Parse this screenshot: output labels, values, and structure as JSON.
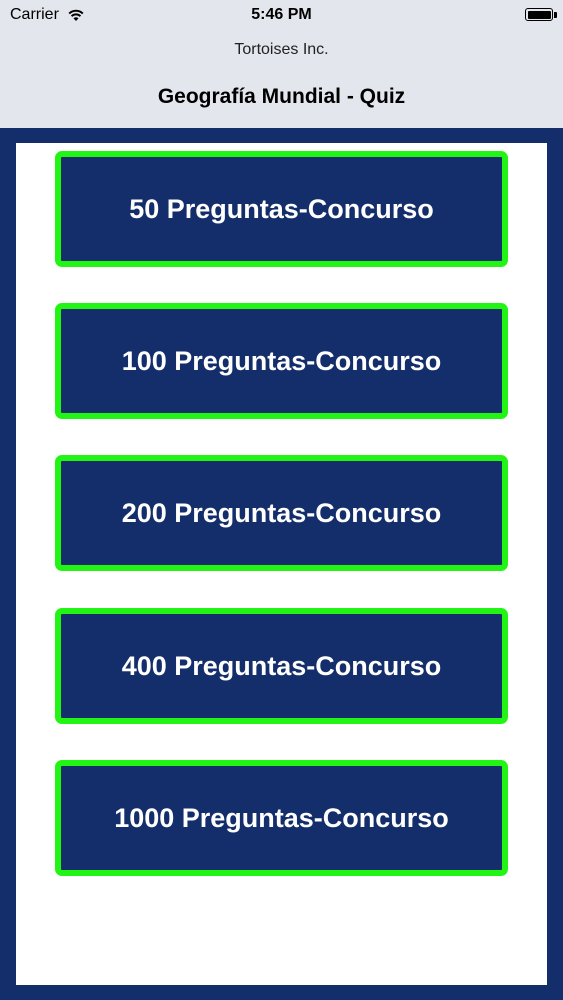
{
  "status_bar": {
    "carrier": "Carrier",
    "time": "5:46 PM"
  },
  "header": {
    "subtitle": "Tortoises Inc.",
    "title": "Geografía Mundial - Quiz"
  },
  "quiz_options": [
    {
      "label": "50 Preguntas-Concurso"
    },
    {
      "label": "100 Preguntas-Concurso"
    },
    {
      "label": "200 Preguntas-Concurso"
    },
    {
      "label": "400 Preguntas-Concurso"
    },
    {
      "label": "1000 Preguntas-Concurso"
    }
  ],
  "colors": {
    "background": "#142d6b",
    "button_fill": "#142d6b",
    "button_border": "#22f514",
    "header_bg": "#e4e6ee"
  }
}
